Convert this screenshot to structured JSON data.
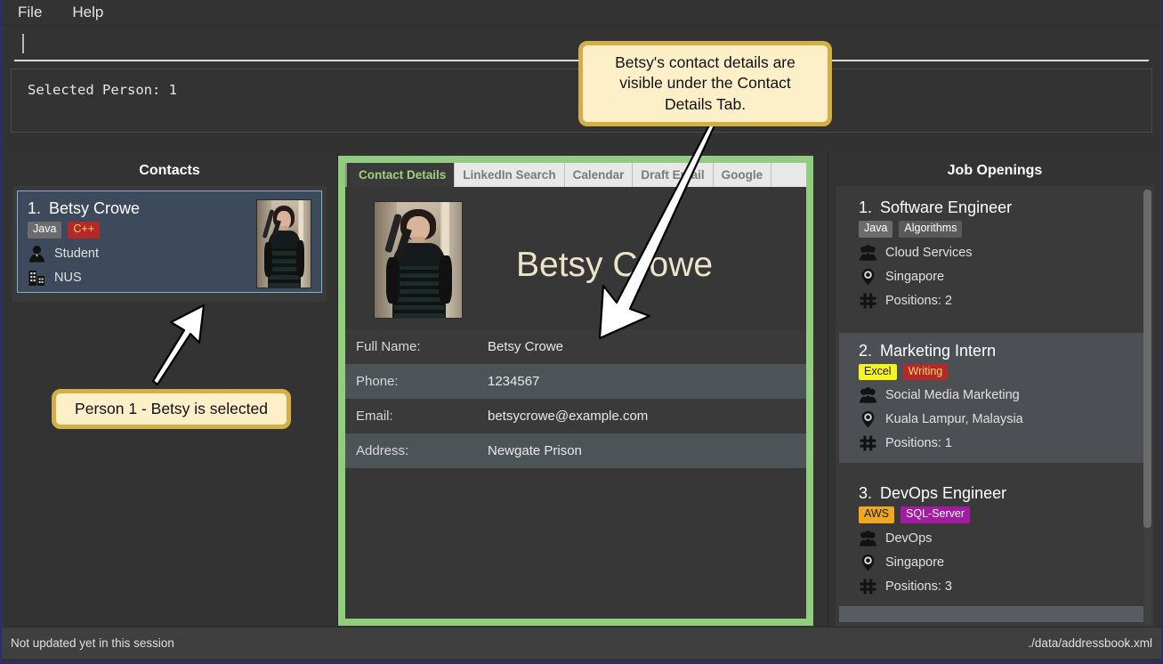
{
  "menu": {
    "items": [
      {
        "label": "File"
      },
      {
        "label": "Help"
      }
    ]
  },
  "search": {
    "value": "",
    "placeholder": ""
  },
  "result": {
    "text": "Selected Person: 1"
  },
  "contacts_panel": {
    "title": "Contacts",
    "items": [
      {
        "index": "1.",
        "name": "Betsy Crowe",
        "tags": [
          {
            "label": "Java",
            "bg": "#6c6c6c",
            "fg": "#ffffff"
          },
          {
            "label": "C++",
            "bg": "#b62828",
            "fg": "#f3d76a"
          }
        ],
        "role": "Student",
        "org": "NUS",
        "photo_alt": "betsy-portrait"
      }
    ]
  },
  "detail_panel": {
    "tabs": [
      {
        "label": "Contact Details",
        "active": true
      },
      {
        "label": "LinkedIn Search",
        "active": false
      },
      {
        "label": "Calendar",
        "active": false
      },
      {
        "label": "Draft Email",
        "active": false
      },
      {
        "label": "Google",
        "active": false
      }
    ],
    "name": "Betsy Crowe",
    "photo_alt": "betsy-portrait-large",
    "fields": [
      {
        "label": "Full Name:",
        "value": "Betsy Crowe"
      },
      {
        "label": "Phone:",
        "value": "1234567"
      },
      {
        "label": "Email:",
        "value": "betsycrowe@example.com"
      },
      {
        "label": "Address:",
        "value": "Newgate Prison"
      }
    ]
  },
  "jobs_panel": {
    "title": "Job Openings",
    "items": [
      {
        "index": "1.",
        "title": "Software Engineer",
        "tags": [
          {
            "label": "Java",
            "bg": "#6c6c6c",
            "fg": "#ffffff"
          },
          {
            "label": "Algorithms",
            "bg": "#5a5a5a",
            "fg": "#ffffff"
          }
        ],
        "department": "Cloud Services",
        "location": "Singapore",
        "positions": "Positions: 2",
        "highlight": false
      },
      {
        "index": "2.",
        "title": "Marketing Intern",
        "tags": [
          {
            "label": "Excel",
            "bg": "#f5f51a",
            "fg": "#1a1a1a"
          },
          {
            "label": "Writing",
            "bg": "#b62828",
            "fg": "#f3d76a"
          }
        ],
        "department": "Social Media Marketing",
        "location": "Kuala Lampur, Malaysia",
        "positions": "Positions: 1",
        "highlight": true
      },
      {
        "index": "3.",
        "title": "DevOps Engineer",
        "tags": [
          {
            "label": "AWS",
            "bg": "#f0a81e",
            "fg": "#1a1a1a"
          },
          {
            "label": "SQL-Server",
            "bg": "#a31aa3",
            "fg": "#ffffff"
          }
        ],
        "department": "DevOps",
        "location": "Singapore",
        "positions": "Positions: 3",
        "highlight": false
      }
    ]
  },
  "statusbar": {
    "left": "Not updated yet in this session",
    "right": "./data/addressbook.xml"
  },
  "annotations": [
    {
      "id": "top",
      "text": "Betsy's contact details are visible under the Contact Details Tab."
    },
    {
      "id": "left",
      "text": "Person 1 - Betsy is selected"
    }
  ],
  "colors": {
    "accent_green": "#92cc7f",
    "tab_active_text": "#9fd07f",
    "selected_card_bg": "#3c4a5b",
    "selected_card_border": "#7fb2cc",
    "annotation_bg": "#fdf0c9",
    "annotation_border": "#d4af47",
    "name_text": "#ece3c8",
    "window_border": "#2a2f6b"
  }
}
